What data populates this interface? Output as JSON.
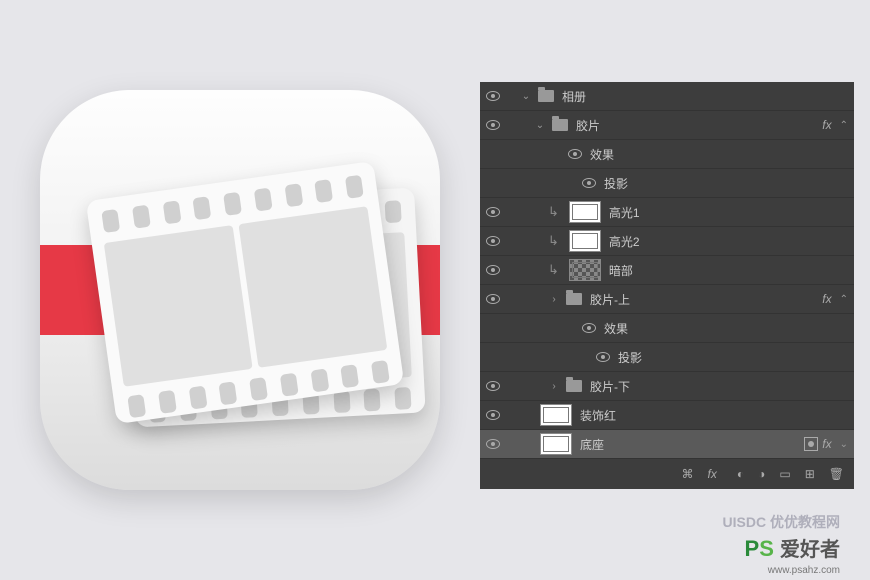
{
  "panel": {
    "group_photo": "相册",
    "group_film": "胶片",
    "fx_effects": "效果",
    "fx_shadow": "投影",
    "layer_highlight1": "高光1",
    "layer_highlight2": "高光2",
    "layer_dark": "暗部",
    "group_film_top": "胶片-上",
    "group_film_bottom": "胶片-下",
    "layer_red": "装饰红",
    "layer_base": "底座",
    "fx_label": "fx"
  },
  "watermarks": {
    "uisdc": "UISDC 优优教程网",
    "ps_p": "P",
    "ps_s": "S",
    "ps_cn": "爱好者",
    "url": "www.psahz.com"
  }
}
